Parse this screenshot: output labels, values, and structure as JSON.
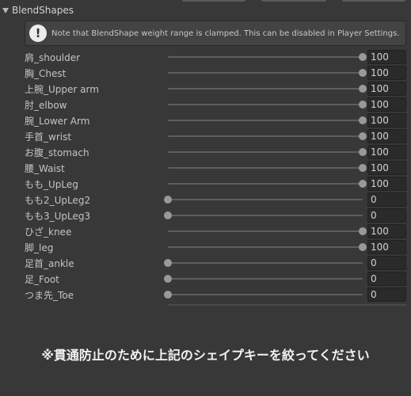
{
  "section": {
    "title": "BlendShapes"
  },
  "help": {
    "text": "Note that BlendShape weight range is clamped. This can be disabled in Player Settings.",
    "icon": "warning-exclamation-icon"
  },
  "slider_range": {
    "min": 0,
    "max": 100
  },
  "blendshapes": [
    {
      "label": "肩_shoulder",
      "value": "100"
    },
    {
      "label": "胸_Chest",
      "value": "100"
    },
    {
      "label": "上腕_Upper arm",
      "value": "100"
    },
    {
      "label": "肘_elbow",
      "value": "100"
    },
    {
      "label": "腕_Lower Arm",
      "value": "100"
    },
    {
      "label": "手首_wrist",
      "value": "100"
    },
    {
      "label": "お腹_stomach",
      "value": "100"
    },
    {
      "label": "腰_Waist",
      "value": "100"
    },
    {
      "label": "もも_UpLeg",
      "value": "100"
    },
    {
      "label": "もも2_UpLeg2",
      "value": "0"
    },
    {
      "label": "もも3_UpLeg3",
      "value": "0"
    },
    {
      "label": "ひざ_knee",
      "value": "100"
    },
    {
      "label": "脚_leg",
      "value": "100"
    },
    {
      "label": "足首_ankle",
      "value": "0"
    },
    {
      "label": "足_Foot",
      "value": "0"
    },
    {
      "label": "つま先_Toe",
      "value": "0"
    }
  ],
  "notice": {
    "text": "※貫通防止のために上記のシェイプキーを絞ってください"
  },
  "colors": {
    "background": "#383838",
    "thumb": "#999999",
    "notice": "#f2f2f2"
  }
}
